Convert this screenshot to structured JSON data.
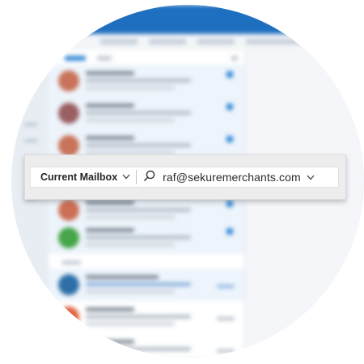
{
  "search": {
    "scope_label": "Current Mailbox",
    "query": "raf@sekuremerchants.com",
    "icons": [
      "chevron-down-icon",
      "search-icon",
      "chevron-down-icon"
    ]
  },
  "colors": {
    "title_bar": "#1e6fc0",
    "unread_flag": "#2e86d6",
    "avatars": [
      "#c9735a",
      "#9a5f63",
      "#c9735a",
      "#cc6f55",
      "#45a548",
      "#2e6fa8",
      "#e0633e"
    ]
  }
}
